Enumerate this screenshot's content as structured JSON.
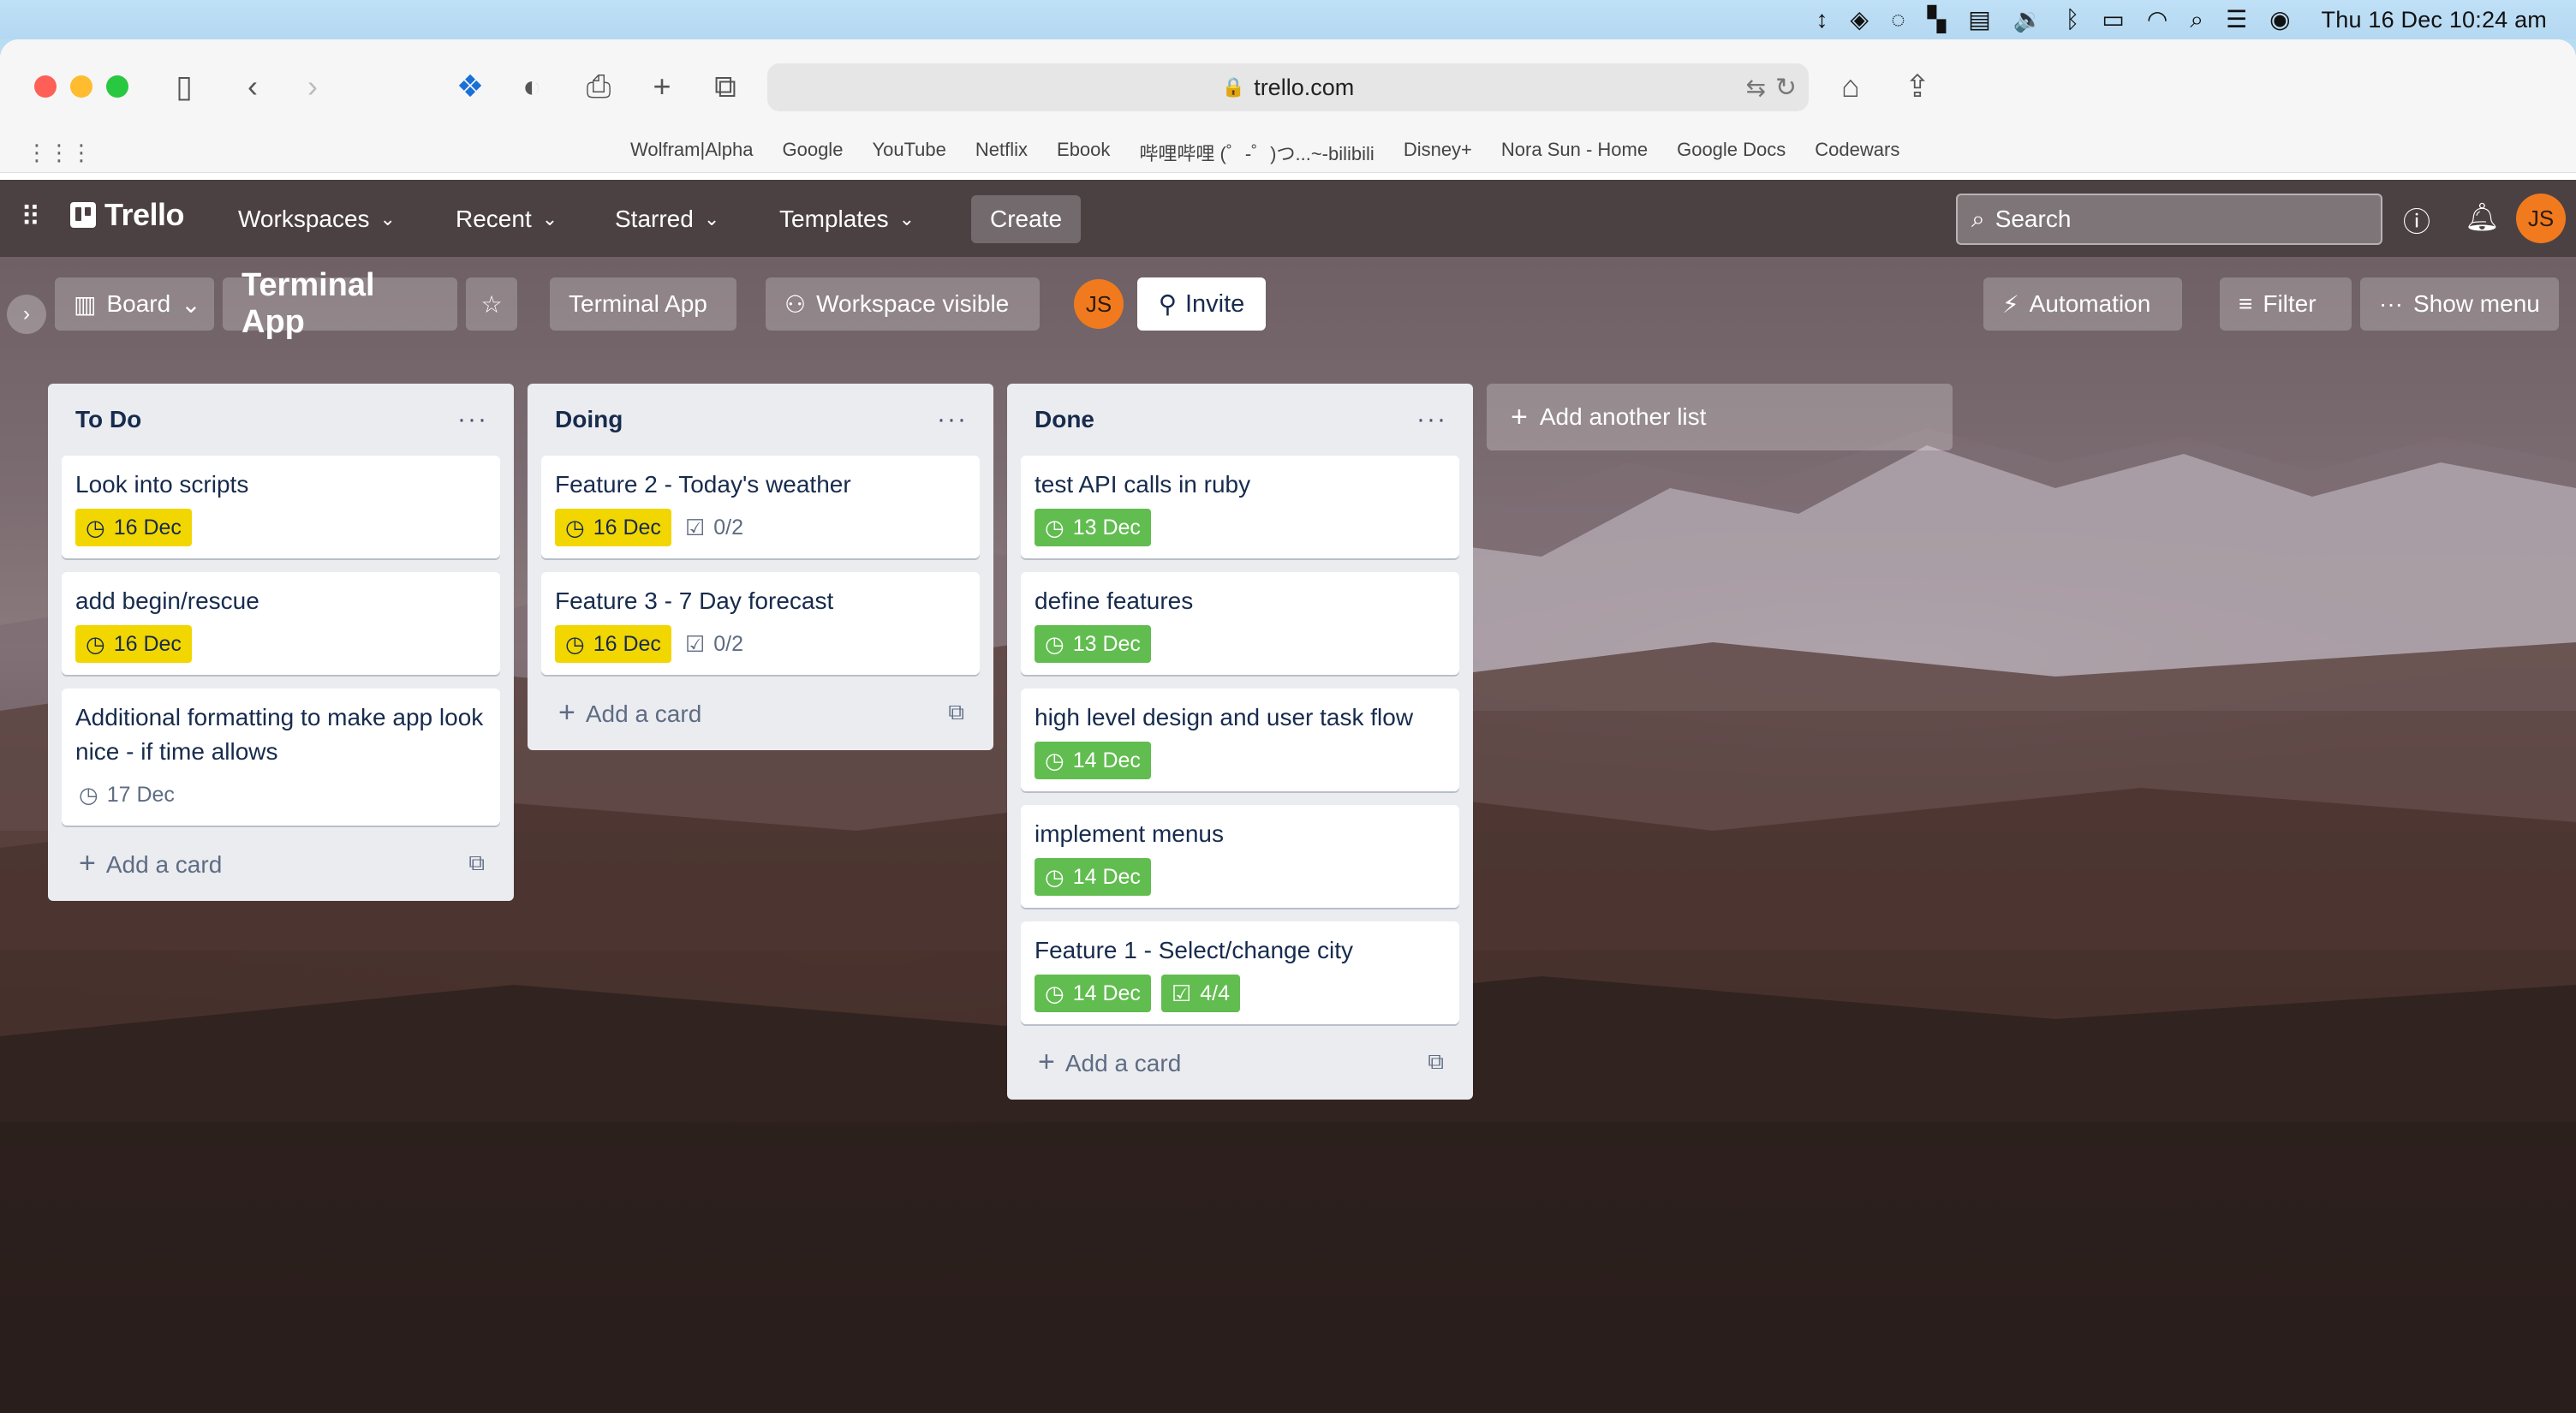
{
  "menubar": {
    "clock": "Thu 16 Dec  10:24 am",
    "icons": [
      "arrows-updown-icon",
      "dropbox-icon",
      "spinner-icon",
      "layout-icon",
      "flag-icon",
      "volume-icon",
      "bluetooth-icon",
      "battery-icon",
      "wifi-icon",
      "spotlight-icon",
      "control-center-icon",
      "siri-icon"
    ]
  },
  "browser": {
    "url": "trello.com",
    "bookmarks": [
      "Wolfram|Alpha",
      "Google",
      "YouTube",
      "Netflix",
      "Ebook",
      "哔哩哔哩 (゜-゜)つ...~-bilibili",
      "Disney+",
      "Nora Sun - Home",
      "Google Docs",
      "Codewars"
    ]
  },
  "header": {
    "logo": "Trello",
    "nav": [
      "Workspaces",
      "Recent",
      "Starred",
      "Templates"
    ],
    "create": "Create",
    "search_placeholder": "Search",
    "avatar": "JS"
  },
  "boardbar": {
    "view": "Board",
    "title": "Terminal App",
    "workspace": "Terminal App",
    "visibility": "Workspace visible",
    "member": "JS",
    "invite": "Invite",
    "automation": "Automation",
    "filter": "Filter",
    "show_menu": "Show menu"
  },
  "lists": [
    {
      "title": "To Do",
      "add_card": "Add a card",
      "cards": [
        {
          "title": "Look into scripts",
          "due": "16 Dec",
          "due_style": "yellow"
        },
        {
          "title": "add begin/rescue",
          "due": "16 Dec",
          "due_style": "yellow"
        },
        {
          "title": "Additional formatting to make app look nice - if time allows",
          "due": "17 Dec",
          "due_style": "plain"
        }
      ]
    },
    {
      "title": "Doing",
      "add_card": "Add a card",
      "cards": [
        {
          "title": "Feature 2 - Today's weather",
          "due": "16 Dec",
          "due_style": "yellow",
          "checklist": "0/2",
          "check_style": "plain"
        },
        {
          "title": "Feature 3 - 7 Day forecast",
          "due": "16 Dec",
          "due_style": "yellow",
          "checklist": "0/2",
          "check_style": "plain"
        }
      ]
    },
    {
      "title": "Done",
      "add_card": "Add a card",
      "cards": [
        {
          "title": "test API calls in ruby",
          "due": "13 Dec",
          "due_style": "green"
        },
        {
          "title": "define features",
          "due": "13 Dec",
          "due_style": "green"
        },
        {
          "title": "high level design and user task flow",
          "due": "14 Dec",
          "due_style": "green"
        },
        {
          "title": "implement menus",
          "due": "14 Dec",
          "due_style": "green"
        },
        {
          "title": "Feature 1 - Select/change city",
          "due": "14 Dec",
          "due_style": "green",
          "checklist": "4/4",
          "check_style": "green"
        }
      ]
    }
  ],
  "add_list": "Add another list",
  "colors": {
    "due_yellow": "#f2d600",
    "due_green": "#61bd4f",
    "list_bg": "#ebecf0",
    "avatar": "#f07a1d"
  }
}
